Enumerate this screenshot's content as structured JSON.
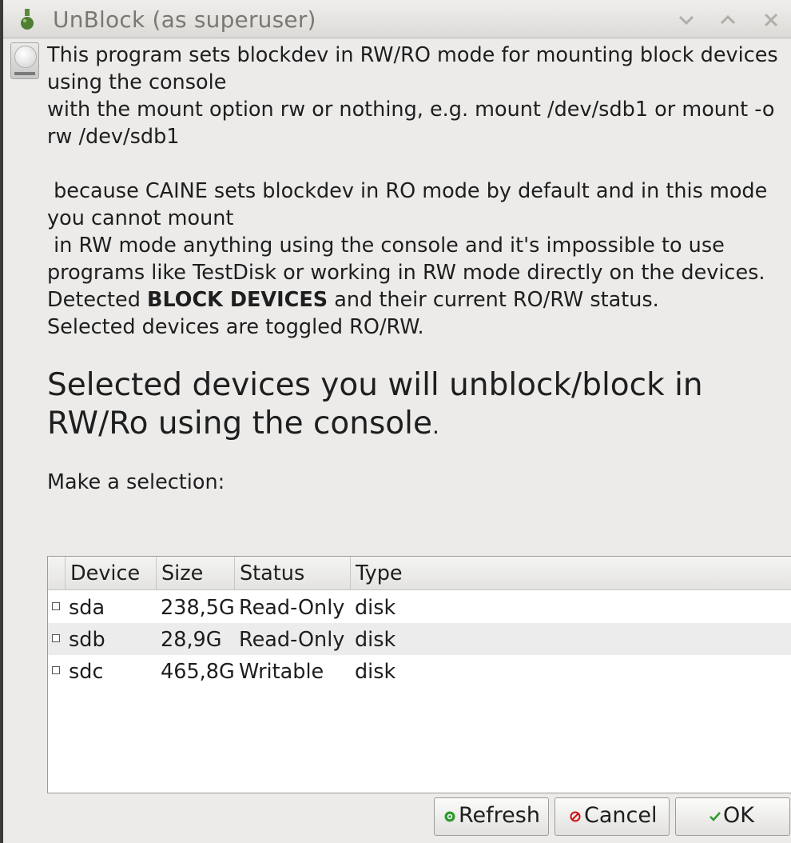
{
  "window": {
    "title": "UnBlock (as superuser)"
  },
  "description": {
    "line1": "This program sets blockdev in RW/RO mode for mounting block devices using the console",
    "line2": "with the mount option rw or nothing, e.g. mount /dev/sdb1 or mount -o rw /dev/sdb1",
    "line3": " because CAINE sets blockdev in RO mode by default and in this mode you cannot mount",
    "line4": " in RW mode anything using the console and it's impossible to use programs like TestDisk or working in RW mode directly on the devices.",
    "line5_prefix": "Detected ",
    "line5_bold": "BLOCK DEVICES",
    "line5_suffix": " and their current RO/RW status.",
    "line6": "Selected devices are toggled RO/RW."
  },
  "headline": {
    "text": "Selected devices you will unblock/block in RW/Ro using the console",
    "period": "."
  },
  "prompt": "Make a selection:",
  "table": {
    "columns": [
      "Device",
      "Size",
      "Status",
      "Type"
    ],
    "rows": [
      {
        "device": "sda",
        "size": "238,5G",
        "status": "Read-Only",
        "type": "disk"
      },
      {
        "device": "sdb",
        "size": "28,9G",
        "status": "Read-Only",
        "type": "disk"
      },
      {
        "device": "sdc",
        "size": "465,8G",
        "status": "Writable",
        "type": "disk"
      }
    ]
  },
  "buttons": {
    "refresh": "Refresh",
    "cancel": "Cancel",
    "ok": "OK"
  },
  "icons": {
    "title": "flask-icon",
    "dialog": "drive-icon",
    "refresh": "refresh-icon",
    "cancel": "cancel-icon",
    "ok": "check-icon"
  },
  "colors": {
    "refresh_icon": "#2e9a2e",
    "cancel_icon": "#d01010",
    "ok_icon": "#2e9a2e"
  }
}
